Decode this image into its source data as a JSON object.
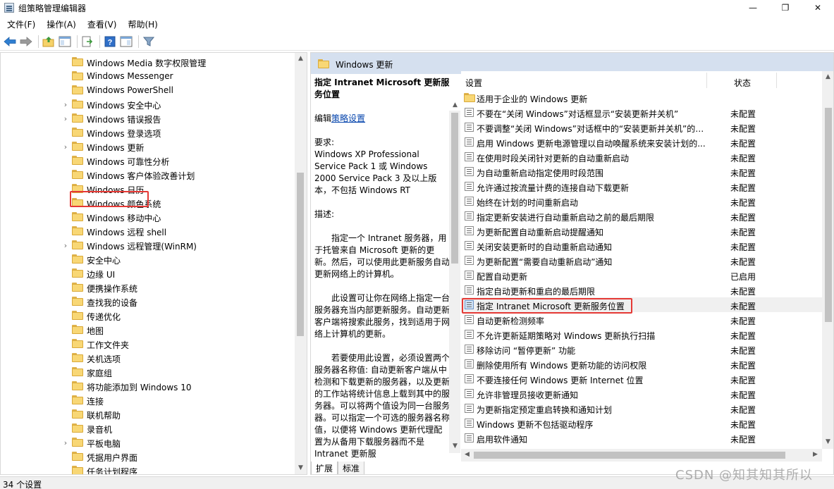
{
  "window": {
    "title": "组策略管理编辑器",
    "minimize": "—",
    "maximize": "❐",
    "close": "✕"
  },
  "menu": [
    "文件(F)",
    "操作(A)",
    "查看(V)",
    "帮助(H)"
  ],
  "toolbar": [
    "back-icon",
    "forward-icon",
    "up-folder-icon",
    "show-hide-tree-icon",
    "export-list-icon",
    "help-icon",
    "properties-view-icon",
    "filter-icon"
  ],
  "tree": {
    "items": [
      {
        "label": "Windows Media 数字权限管理",
        "expandable": false
      },
      {
        "label": "Windows Messenger",
        "expandable": false
      },
      {
        "label": "Windows PowerShell",
        "expandable": false
      },
      {
        "label": "Windows 安全中心",
        "expandable": true
      },
      {
        "label": "Windows 错误报告",
        "expandable": true
      },
      {
        "label": "Windows 登录选项",
        "expandable": false
      },
      {
        "label": "Windows 更新",
        "expandable": true,
        "selected": true
      },
      {
        "label": "Windows 可靠性分析",
        "expandable": false
      },
      {
        "label": "Windows 客户体验改善计划",
        "expandable": false
      },
      {
        "label": "Windows 日历",
        "expandable": false
      },
      {
        "label": "Windows 颜色系统",
        "expandable": false
      },
      {
        "label": "Windows 移动中心",
        "expandable": false
      },
      {
        "label": "Windows 远程 shell",
        "expandable": false
      },
      {
        "label": "Windows 远程管理(WinRM)",
        "expandable": true
      },
      {
        "label": "安全中心",
        "expandable": false
      },
      {
        "label": "边缘 UI",
        "expandable": false
      },
      {
        "label": "便携操作系统",
        "expandable": false
      },
      {
        "label": "查找我的设备",
        "expandable": false
      },
      {
        "label": "传递优化",
        "expandable": false
      },
      {
        "label": "地图",
        "expandable": false
      },
      {
        "label": "工作文件夹",
        "expandable": false
      },
      {
        "label": "关机选项",
        "expandable": false
      },
      {
        "label": "家庭组",
        "expandable": false
      },
      {
        "label": "将功能添加到 Windows 10",
        "expandable": false
      },
      {
        "label": "连接",
        "expandable": false
      },
      {
        "label": "联机帮助",
        "expandable": false
      },
      {
        "label": "录音机",
        "expandable": false
      },
      {
        "label": "平板电脑",
        "expandable": true
      },
      {
        "label": "凭据用户界面",
        "expandable": false
      },
      {
        "label": "任务计划程序",
        "expandable": false
      }
    ]
  },
  "right": {
    "header": "Windows 更新",
    "description": {
      "title": "指定 Intranet Microsoft 更新服务位置",
      "edit_prefix": "编辑",
      "edit_link": "策略设置",
      "requirements_label": "要求:",
      "requirements": "Windows XP Professional Service Pack 1 或 Windows 2000 Service Pack 3 及以上版本，不包括 Windows RT",
      "description_label": "描述:",
      "para1": "指定一个 Intranet 服务器，用于托管来自 Microsoft 更新的更新。然后，可以使用此更新服务自动更新网络上的计算机。",
      "para2": "此设置可让你在网络上指定一台服务器充当内部更新服务。自动更新客户端将搜索此服务，找到适用于网络上计算机的更新。",
      "para3": "若要使用此设置，必须设置两个服务器名称值: 自动更新客户端从中检测和下载更新的服务器，以及更新的工作站将统计信息上载到其中的服务器。可以将两个值设为同一台服务器。可以指定一个可选的服务器名称值，以便将 Windows 更新代理配置为从备用下载服务器而不是 Intranet 更新服"
    },
    "tabs": [
      "扩展",
      "标准"
    ],
    "list": {
      "col_setting": "设置",
      "col_state": "状态",
      "folder_row": "适用于企业的 Windows 更新",
      "rows": [
        {
          "label": "不要在“关闭 Windows”对话框显示“安装更新并关机”",
          "state": "未配置"
        },
        {
          "label": "不要调整“关闭 Windows”对话框中的“安装更新并关机”的默...",
          "state": "未配置"
        },
        {
          "label": "启用 Windows 更新电源管理以自动唤醒系统来安装计划的...",
          "state": "未配置"
        },
        {
          "label": "在使用时段关闭针对更新的自动重新启动",
          "state": "未配置"
        },
        {
          "label": "为自动重新启动指定使用时段范围",
          "state": "未配置"
        },
        {
          "label": "允许通过按流量计费的连接自动下载更新",
          "state": "未配置"
        },
        {
          "label": "始终在计划的时间重新启动",
          "state": "未配置"
        },
        {
          "label": "指定更新安装进行自动重新启动之前的最后期限",
          "state": "未配置"
        },
        {
          "label": "为更新配置自动重新启动提醒通知",
          "state": "未配置"
        },
        {
          "label": "关闭安装更新时的自动重新启动通知",
          "state": "未配置"
        },
        {
          "label": "为更新配置“需要自动重新启动”通知",
          "state": "未配置"
        },
        {
          "label": "配置自动更新",
          "state": "已启用"
        },
        {
          "label": "指定自动更新和重启的最后期限",
          "state": "未配置"
        },
        {
          "label": "指定 Intranet Microsoft 更新服务位置",
          "state": "未配置",
          "selected": true
        },
        {
          "label": "自动更新检测频率",
          "state": "未配置"
        },
        {
          "label": "不允许更新延期策略对 Windows 更新执行扫描",
          "state": "未配置"
        },
        {
          "label": "移除访问 “暂停更新” 功能",
          "state": "未配置"
        },
        {
          "label": "删除使用所有 Windows 更新功能的访问权限",
          "state": "未配置"
        },
        {
          "label": "不要连接任何 Windows 更新 Internet 位置",
          "state": "未配置"
        },
        {
          "label": "允许非管理员接收更新通知",
          "state": "未配置"
        },
        {
          "label": "为更新指定预定重启转换和通知计划",
          "state": "未配置"
        },
        {
          "label": "Windows 更新不包括驱动程序",
          "state": "未配置"
        },
        {
          "label": "启用软件通知",
          "state": "未配置"
        }
      ]
    }
  },
  "status": "34 个设置",
  "watermark": "CSDN @知其知其所以"
}
